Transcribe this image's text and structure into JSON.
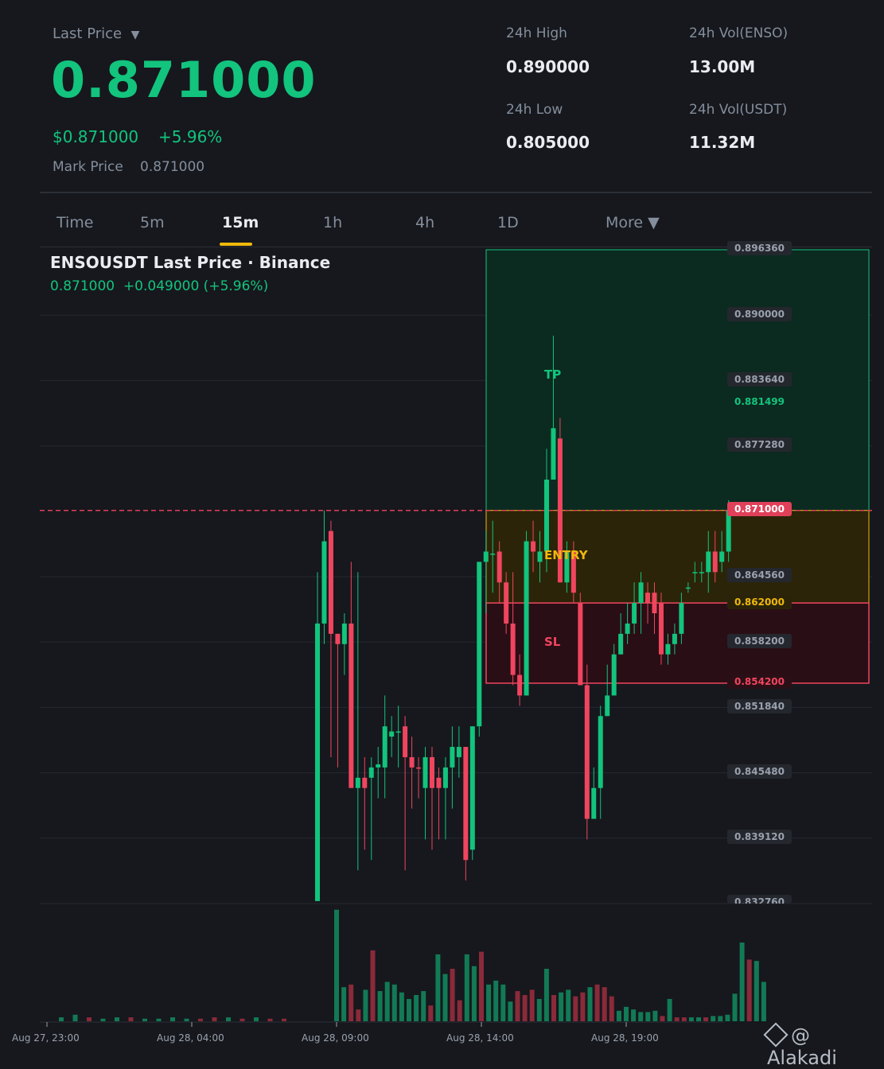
{
  "header": {
    "last_price_label": "Last Price",
    "dropdown_glyph": "▼",
    "last_price": "0.871000",
    "usd_price": "$0.871000",
    "change_pct": "+5.96%",
    "mark_price_label": "Mark Price",
    "mark_price": "0.871000",
    "stats": {
      "high_label": "24h High",
      "high": "0.890000",
      "low_label": "24h Low",
      "low": "0.805000",
      "vol_base_label": "24h Vol(ENSO)",
      "vol_base": "13.00M",
      "vol_quote_label": "24h Vol(USDT)",
      "vol_quote": "11.32M"
    }
  },
  "tabs": [
    {
      "label": "Time"
    },
    {
      "label": "5m"
    },
    {
      "label": "15m",
      "active": true
    },
    {
      "label": "1h"
    },
    {
      "label": "4h"
    },
    {
      "label": "1D"
    },
    {
      "label": "More ▼"
    }
  ],
  "chart_title": "ENSOUSDT Last Price · Binance",
  "chart_subtitle": "0.871000  +0.049000 (+5.96%)",
  "watermark": "@ Alakadi",
  "colors": {
    "up": "#12c47d",
    "down": "#f0455f",
    "bg": "#16181d",
    "entry": "#f0b90b"
  },
  "chart_data": {
    "type": "candlestick",
    "y_ticks": [
      "0.896360",
      "0.890000",
      "0.883640",
      "0.877280",
      "0.864560",
      "0.858200",
      "0.851840",
      "0.845480",
      "0.839120",
      "0.832760"
    ],
    "ylim": [
      0.83276,
      0.89636
    ],
    "x_ticks": [
      "Aug 27, 23:00",
      "Aug 28, 04:00",
      "Aug 28, 09:00",
      "Aug 28, 14:00",
      "Aug 28, 19:00"
    ],
    "last_price_line": 0.871,
    "last_price_label": "0.871000",
    "position": {
      "take_profit": 0.881499,
      "take_profit_label": "0.881499",
      "tp_text": "TP",
      "entry": 0.862,
      "entry_label": "0.862000",
      "entry_text": "ENTRY",
      "stop_loss": 0.8542,
      "stop_loss_label": "0.854200",
      "sl_text": "SL",
      "zone_top": 0.89636
    },
    "candles": [
      [
        0.833,
        0.86,
        0.833,
        0.865
      ],
      [
        0.86,
        0.868,
        0.858,
        0.871
      ],
      [
        0.869,
        0.859,
        0.847,
        0.87
      ],
      [
        0.859,
        0.858,
        0.846,
        0.859
      ],
      [
        0.858,
        0.86,
        0.855,
        0.861
      ],
      [
        0.86,
        0.844,
        0.846,
        0.866
      ],
      [
        0.844,
        0.845,
        0.836,
        0.865
      ],
      [
        0.845,
        0.844,
        0.838,
        0.847
      ],
      [
        0.845,
        0.846,
        0.837,
        0.847
      ],
      [
        0.846,
        0.8463,
        0.843,
        0.848
      ],
      [
        0.846,
        0.85,
        0.843,
        0.853
      ],
      [
        0.849,
        0.8495,
        0.847,
        0.851
      ],
      [
        0.8495,
        0.8495,
        0.846,
        0.852
      ],
      [
        0.85,
        0.847,
        0.836,
        0.851
      ],
      [
        0.847,
        0.846,
        0.842,
        0.849
      ],
      [
        0.846,
        0.8459,
        0.843,
        0.847
      ],
      [
        0.844,
        0.847,
        0.839,
        0.848
      ],
      [
        0.847,
        0.844,
        0.838,
        0.848
      ],
      [
        0.845,
        0.844,
        0.839,
        0.846
      ],
      [
        0.844,
        0.846,
        0.839,
        0.847
      ],
      [
        0.846,
        0.848,
        0.842,
        0.85
      ],
      [
        0.847,
        0.848,
        0.845,
        0.85
      ],
      [
        0.848,
        0.837,
        0.835,
        0.848
      ],
      [
        0.838,
        0.85,
        0.837,
        0.85
      ],
      [
        0.85,
        0.866,
        0.849,
        0.866
      ],
      [
        0.866,
        0.867,
        0.861,
        0.869
      ],
      [
        0.8668,
        0.8668,
        0.863,
        0.87
      ],
      [
        0.867,
        0.864,
        0.862,
        0.868
      ],
      [
        0.864,
        0.86,
        0.859,
        0.865
      ],
      [
        0.86,
        0.855,
        0.854,
        0.865
      ],
      [
        0.855,
        0.853,
        0.852,
        0.857
      ],
      [
        0.853,
        0.868,
        0.853,
        0.869
      ],
      [
        0.868,
        0.867,
        0.865,
        0.87
      ],
      [
        0.866,
        0.867,
        0.864,
        0.869
      ],
      [
        0.867,
        0.874,
        0.865,
        0.877
      ],
      [
        0.874,
        0.879,
        0.874,
        0.888
      ],
      [
        0.878,
        0.864,
        0.864,
        0.88
      ],
      [
        0.864,
        0.867,
        0.863,
        0.868
      ],
      [
        0.867,
        0.863,
        0.862,
        0.868
      ],
      [
        0.862,
        0.854,
        0.854,
        0.863
      ],
      [
        0.854,
        0.841,
        0.839,
        0.856
      ],
      [
        0.841,
        0.844,
        0.841,
        0.846
      ],
      [
        0.844,
        0.851,
        0.841,
        0.852
      ],
      [
        0.851,
        0.853,
        0.851,
        0.856
      ],
      [
        0.853,
        0.857,
        0.853,
        0.858
      ],
      [
        0.857,
        0.859,
        0.857,
        0.861
      ],
      [
        0.859,
        0.86,
        0.858,
        0.862
      ],
      [
        0.86,
        0.862,
        0.859,
        0.864
      ],
      [
        0.862,
        0.864,
        0.859,
        0.865
      ],
      [
        0.863,
        0.862,
        0.86,
        0.864
      ],
      [
        0.863,
        0.861,
        0.859,
        0.864
      ],
      [
        0.862,
        0.857,
        0.856,
        0.863
      ],
      [
        0.857,
        0.858,
        0.856,
        0.859
      ],
      [
        0.858,
        0.859,
        0.857,
        0.86
      ],
      [
        0.859,
        0.862,
        0.858,
        0.863
      ],
      [
        0.8635,
        0.8635,
        0.863,
        0.864
      ],
      [
        0.865,
        0.865,
        0.864,
        0.866
      ],
      [
        0.865,
        0.865,
        0.864,
        0.866
      ],
      [
        0.865,
        0.867,
        0.863,
        0.869
      ],
      [
        0.867,
        0.865,
        0.864,
        0.869
      ],
      [
        0.866,
        0.867,
        0.865,
        0.869
      ],
      [
        0.867,
        0.871,
        0.866,
        0.872
      ]
    ],
    "volumes": [
      [
        0.3,
        0
      ],
      [
        0.5,
        0
      ],
      [
        0.3,
        1
      ],
      [
        0.2,
        0
      ],
      [
        0.3,
        0
      ],
      [
        0.3,
        1
      ],
      [
        0.2,
        0
      ],
      [
        0.2,
        0
      ],
      [
        0.3,
        0
      ],
      [
        0.2,
        0
      ],
      [
        0.2,
        1
      ],
      [
        0.3,
        1
      ],
      [
        0.3,
        0
      ],
      [
        0.2,
        1
      ],
      [
        0.3,
        0
      ],
      [
        0.2,
        1
      ],
      [
        0.2,
        1
      ],
      [
        8.5,
        0
      ],
      [
        2.6,
        0
      ],
      [
        2.8,
        1
      ],
      [
        0.9,
        1
      ],
      [
        2.4,
        0
      ],
      [
        5.4,
        1
      ],
      [
        2.3,
        0
      ],
      [
        3.0,
        0
      ],
      [
        2.8,
        0
      ],
      [
        2.2,
        0
      ],
      [
        1.7,
        0
      ],
      [
        2.0,
        0
      ],
      [
        2.3,
        0
      ],
      [
        1.2,
        1
      ],
      [
        5.1,
        0
      ],
      [
        3.6,
        0
      ],
      [
        4.0,
        1
      ],
      [
        1.6,
        1
      ],
      [
        5.1,
        0
      ],
      [
        4.2,
        0
      ],
      [
        5.3,
        1
      ],
      [
        2.8,
        0
      ],
      [
        3.1,
        0
      ],
      [
        2.8,
        0
      ],
      [
        1.5,
        0
      ],
      [
        2.3,
        1
      ],
      [
        2.0,
        1
      ],
      [
        2.4,
        1
      ],
      [
        1.7,
        0
      ],
      [
        4.0,
        0
      ],
      [
        2.0,
        1
      ],
      [
        2.2,
        0
      ],
      [
        2.4,
        0
      ],
      [
        1.9,
        1
      ],
      [
        2.2,
        1
      ],
      [
        2.6,
        0
      ],
      [
        2.8,
        1
      ],
      [
        2.6,
        1
      ],
      [
        1.9,
        1
      ],
      [
        0.8,
        0
      ],
      [
        1.1,
        0
      ],
      [
        0.9,
        0
      ],
      [
        0.7,
        0
      ],
      [
        0.7,
        0
      ],
      [
        0.8,
        0
      ],
      [
        0.4,
        1
      ],
      [
        1.7,
        0
      ],
      [
        0.3,
        1
      ],
      [
        0.3,
        1
      ],
      [
        0.3,
        0
      ],
      [
        0.3,
        0
      ],
      [
        0.3,
        1
      ],
      [
        0.4,
        0
      ],
      [
        0.4,
        0
      ],
      [
        0.5,
        0
      ],
      [
        2.1,
        0
      ],
      [
        6.0,
        0
      ],
      [
        4.7,
        1
      ],
      [
        4.6,
        0
      ],
      [
        3.0,
        0
      ]
    ]
  }
}
